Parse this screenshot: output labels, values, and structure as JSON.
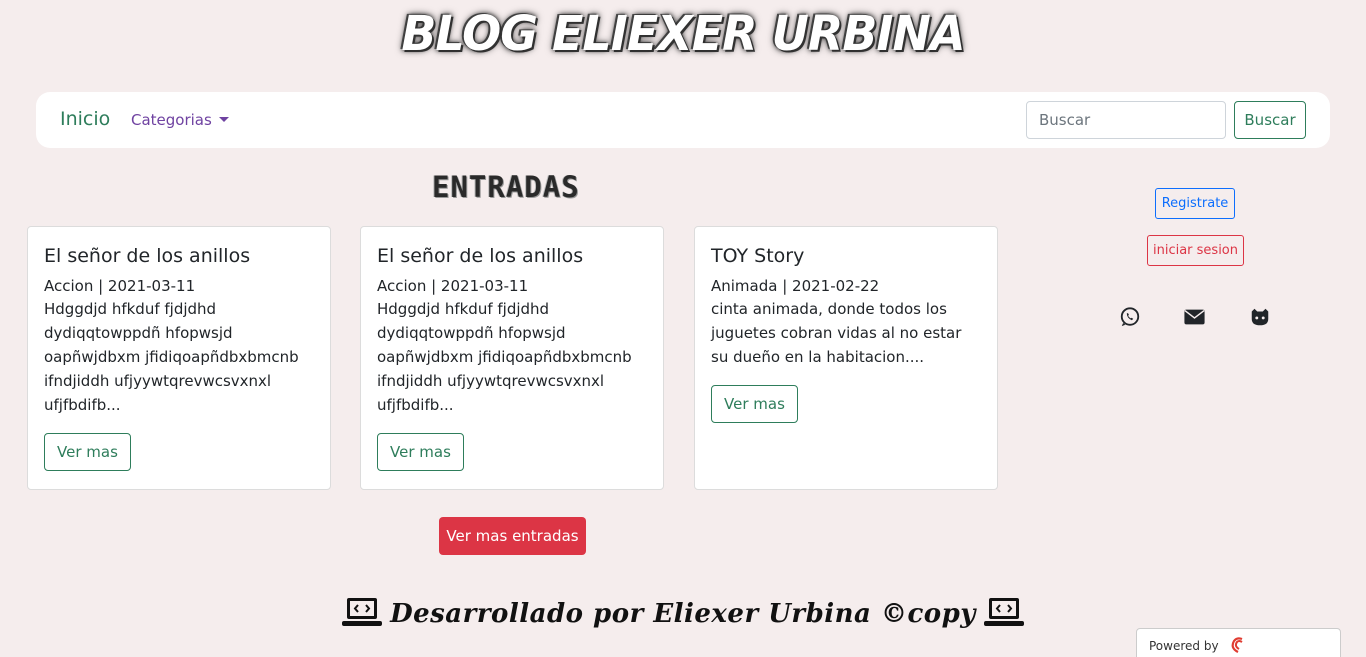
{
  "header": {
    "logo": "BLOG ELIEXER URBINA"
  },
  "nav": {
    "home": "Inicio",
    "categories": "Categorias",
    "search_placeholder": "Buscar",
    "search_button": "Buscar"
  },
  "section_title": "ENTRADAS",
  "cards": [
    {
      "title": "El señor de los anillos",
      "meta": "Accion | 2021-03-11",
      "text": "Hdggdjd hfkduf fjdjdhd dydiqqtowppdñ hfopwsjd oapñwjdbxm jfidiqoapñdbxbmcnb ifndjiddh ufjyywtqrevwcsvxnxl ufjfbdifb...",
      "button": "Ver mas"
    },
    {
      "title": "El señor de los anillos",
      "meta": "Accion | 2021-03-11",
      "text": "Hdggdjd hfkduf fjdjdhd dydiqqtowppdñ hfopwsjd oapñwjdbxm jfidiqoapñdbxbmcnb ifndjiddh ufjyywtqrevwcsvxnxl ufjfbdifb...",
      "button": "Ver mas"
    },
    {
      "title": "TOY Story",
      "meta": "Animada | 2021-02-22",
      "text": "cinta animada, donde todos los juguetes cobran vidas al no estar su dueño en la habitacion....",
      "button": "Ver mas"
    }
  ],
  "more_button": "Ver mas entradas",
  "sidebar": {
    "register": "Registrate",
    "login": "iniciar sesion",
    "icons": [
      "whatsapp-icon",
      "envelope-icon",
      "github-icon"
    ]
  },
  "footer": {
    "text": "Desarrollado por Eliexer Urbina ©copy"
  },
  "powered": {
    "label": "Powered by",
    "brand": "000webhost"
  },
  "colors": {
    "background": "#f5eded",
    "accent_green": "#2e7d5b",
    "danger": "#dc3545",
    "primary": "#0d6efd"
  }
}
